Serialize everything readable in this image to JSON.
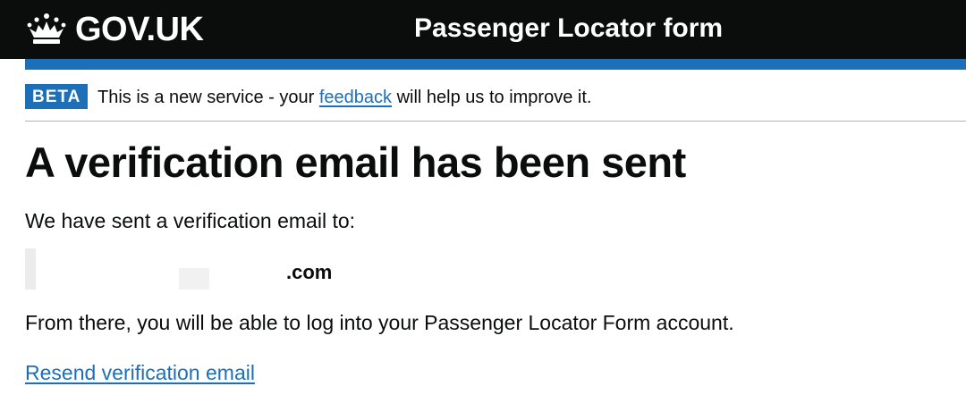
{
  "header": {
    "logo_text": "GOV.UK",
    "logo_icon": "crown-icon",
    "service_name": "Passenger Locator form"
  },
  "phase_banner": {
    "tag": "BETA",
    "text_before": "This is a new service - your ",
    "link": "feedback",
    "text_after": " will help us to improve it."
  },
  "main": {
    "heading": "A verification email has been sent",
    "sent_to_text": "We have sent a verification email to:",
    "email_visible_suffix": ".com",
    "login_text": "From there, you will be able to log into your Passenger Locator Form account.",
    "resend_link": "Resend verification email"
  },
  "colors": {
    "header_bg": "#0b0c0c",
    "brand_blue": "#1d70b8",
    "text": "#0b0c0c"
  }
}
